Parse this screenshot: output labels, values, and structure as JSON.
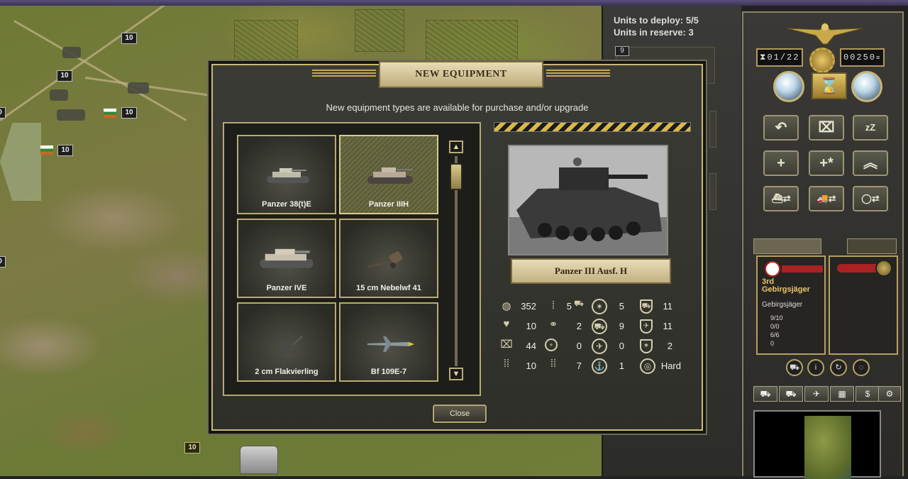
{
  "deploy": {
    "units_to_deploy": "Units to deploy: 5/5",
    "units_in_reserve": "Units in reserve: 3",
    "slot_number": "9"
  },
  "map": {
    "badges": [
      "10",
      "10",
      "10",
      "10",
      "10",
      "10",
      "10"
    ],
    "edge_labels": [
      "0",
      "0"
    ]
  },
  "side": {
    "turn_current": "01",
    "turn_total": "22",
    "prestige": "00250"
  },
  "unit": {
    "name": "3rd Gebirgsjäger",
    "type": "Gebirgsjäger",
    "strength": "9/10",
    "entrenchment": "0/0",
    "ammo": "6/6",
    "fuel": "0"
  },
  "dialog": {
    "title": "NEW EQUIPMENT",
    "subtitle": "New equipment types are available for purchase and/or upgrade",
    "items": [
      "Panzer 38(t)E",
      "Panzer IIIH",
      "Panzer IVE",
      "15 cm Nebelwf 41",
      "2 cm Flakvierling",
      "Bf 109E-7"
    ],
    "selected_name": "Panzer III Ausf. H",
    "stats": {
      "cost": "352",
      "movement": "5",
      "spotting": "2",
      "soft_attack": "5",
      "air_attack": "9",
      "close_defense": "0",
      "ground_defense": "11",
      "air_defense": "11",
      "initiative_def": "2",
      "strength": "10",
      "ammo": "44",
      "fuel": "10",
      "range": "0",
      "hard_attack": "1",
      "move_type": "7",
      "target_type": "Hard"
    },
    "close_label": "Close"
  },
  "colors": {
    "accent": "#c9b87a",
    "plate": "#e7dcb6",
    "hazard": "#d8b84a"
  }
}
